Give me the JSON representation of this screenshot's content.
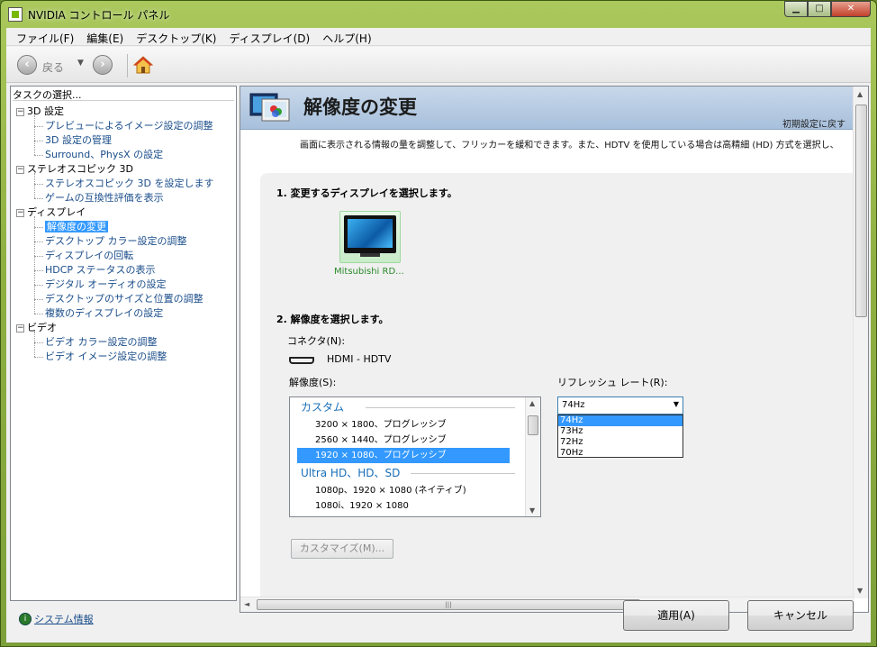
{
  "window": {
    "title": "NVIDIA コントロール パネル"
  },
  "menu": [
    "ファイル(F)",
    "編集(E)",
    "デスクトップ(K)",
    "ディスプレイ(D)",
    "ヘルプ(H)"
  ],
  "toolbar": {
    "back_label": "戻る"
  },
  "left_panel": {
    "header": "タスクの選択...",
    "groups": [
      {
        "label": "3D 設定",
        "items": [
          "プレビューによるイメージ設定の調整",
          "3D 設定の管理",
          "Surround、PhysX の設定"
        ]
      },
      {
        "label": "ステレオスコピック 3D",
        "items": [
          "ステレオスコピック 3D を設定します",
          "ゲームの互換性評価を表示"
        ]
      },
      {
        "label": "ディスプレイ",
        "items": [
          "解像度の変更",
          "デスクトップ カラー設定の調整",
          "ディスプレイの回転",
          "HDCP ステータスの表示",
          "デジタル オーディオの設定",
          "デスクトップのサイズと位置の調整",
          "複数のディスプレイの設定"
        ]
      },
      {
        "label": "ビデオ",
        "items": [
          "ビデオ カラー設定の調整",
          "ビデオ イメージ設定の調整"
        ]
      }
    ],
    "system_info": "システム情報"
  },
  "page": {
    "title": "解像度の変更",
    "restore_link": "初期設定に戻す",
    "description": "画面に表示される情報の量を調整して、フリッカーを緩和できます。また、HDTV を使用している場合は高精細 (HD) 方式を選択し、",
    "step1_title": "1. 変更するディスプレイを選択します。",
    "display_name": "Mitsubishi RD...",
    "step2_title": "2. 解像度を選択します。",
    "connector_label": "コネクタ(N):",
    "connector_value": "HDMI - HDTV",
    "resolution_label": "解像度(S):",
    "resolution_list": {
      "group1": "カスタム",
      "custom_items": [
        "3200 × 1800、プログレッシブ",
        "2560 × 1440、プログレッシブ",
        "1920 × 1080、プログレッシブ"
      ],
      "group2": "Ultra HD、HD、SD",
      "hd_items": [
        "1080p、1920 × 1080 (ネイティブ)",
        "1080i、1920 × 1080"
      ]
    },
    "refresh_label": "リフレッシュ レート(R):",
    "refresh_selected": "74Hz",
    "refresh_options": [
      "74Hz",
      "73Hz",
      "72Hz",
      "70Hz"
    ],
    "customize_button": "カスタマイズ(M)..."
  },
  "buttons": {
    "apply": "適用(A)",
    "cancel": "キャンセル"
  }
}
